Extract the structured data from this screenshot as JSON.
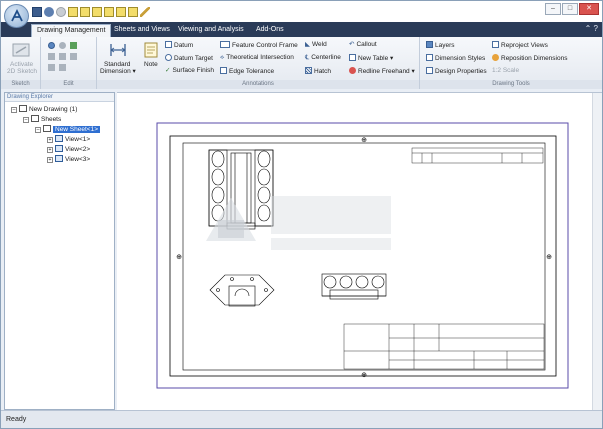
{
  "tabs": [
    "Drawing Management",
    "Sheets and Views",
    "Viewing and Analysis",
    "Add-Ons"
  ],
  "ribbon": {
    "sketch": {
      "label": "Sketch",
      "activate": "Activate",
      "activate2": "2D Sketch"
    },
    "edit": {
      "label": "Edit"
    },
    "annotations": {
      "label": "Annotations",
      "standard_dimension": "Standard",
      "standard_dimension2": "Dimension",
      "note": "Note",
      "datum": "Datum",
      "datum_target": "Datum Target",
      "surface_finish": "Surface Finish",
      "feature_control_frame": "Feature Control Frame",
      "theoretical_intersection": "Theoretical Intersection",
      "edge_tolerance": "Edge Tolerance",
      "weld": "Weld",
      "centerline": "Centerline",
      "hatch": "Hatch",
      "callout": "Callout",
      "new_table": "New Table",
      "redline_freehand": "Redline Freehand"
    },
    "drawing_tools": {
      "label": "Drawing Tools",
      "layers": "Layers",
      "dimension_styles": "Dimension Styles",
      "design_properties": "Design Properties",
      "scale": "1:2 Scale",
      "reproject_views": "Reproject Views",
      "reposition_dimensions": "Reposition Dimensions"
    }
  },
  "explorer": {
    "title": "Drawing Explorer",
    "root": "New Drawing (1)",
    "sheets": "Sheets",
    "sheet1": "New Sheet<1>",
    "views": [
      "View<1>",
      "View<2>",
      "View<3>"
    ]
  },
  "status": "Ready"
}
